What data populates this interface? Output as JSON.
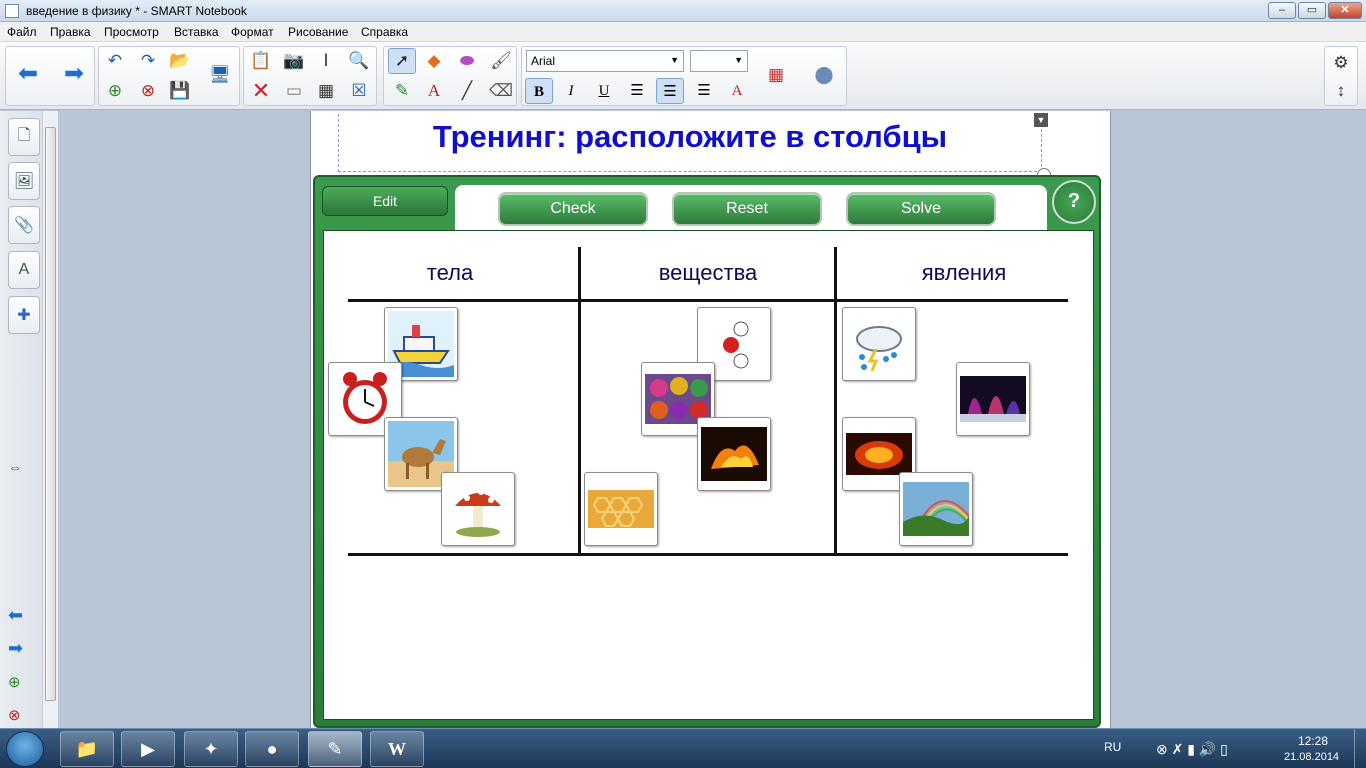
{
  "window": {
    "title": "введение в физику * - SMART Notebook"
  },
  "menu": [
    "Файл",
    "Правка",
    "Просмотр",
    "Вставка",
    "Формат",
    "Рисование",
    "Справка"
  ],
  "toolbar": {
    "font_name": "Arial",
    "font_size": "",
    "bold_label": "B",
    "italic_label": "I",
    "underline_label": "U"
  },
  "page": {
    "heading": "Тренинг: расположите в столбцы",
    "buttons": {
      "edit": "Edit",
      "check": "Check",
      "reset": "Reset",
      "solve": "Solve",
      "help": "?"
    },
    "columns": [
      "тела",
      "вещества",
      "явления"
    ],
    "cards": {
      "bodies": [
        "ship",
        "alarm-clock",
        "camel",
        "mushrooms"
      ],
      "substances": [
        "water-molecule",
        "colored-powders",
        "molten-metal",
        "honeycomb"
      ],
      "phenomena": [
        "rain-cloud",
        "aurora",
        "eclipse-glow",
        "rainbow"
      ]
    }
  },
  "taskbar": {
    "language": "RU",
    "time": "12:28",
    "date": "21.08.2014"
  }
}
